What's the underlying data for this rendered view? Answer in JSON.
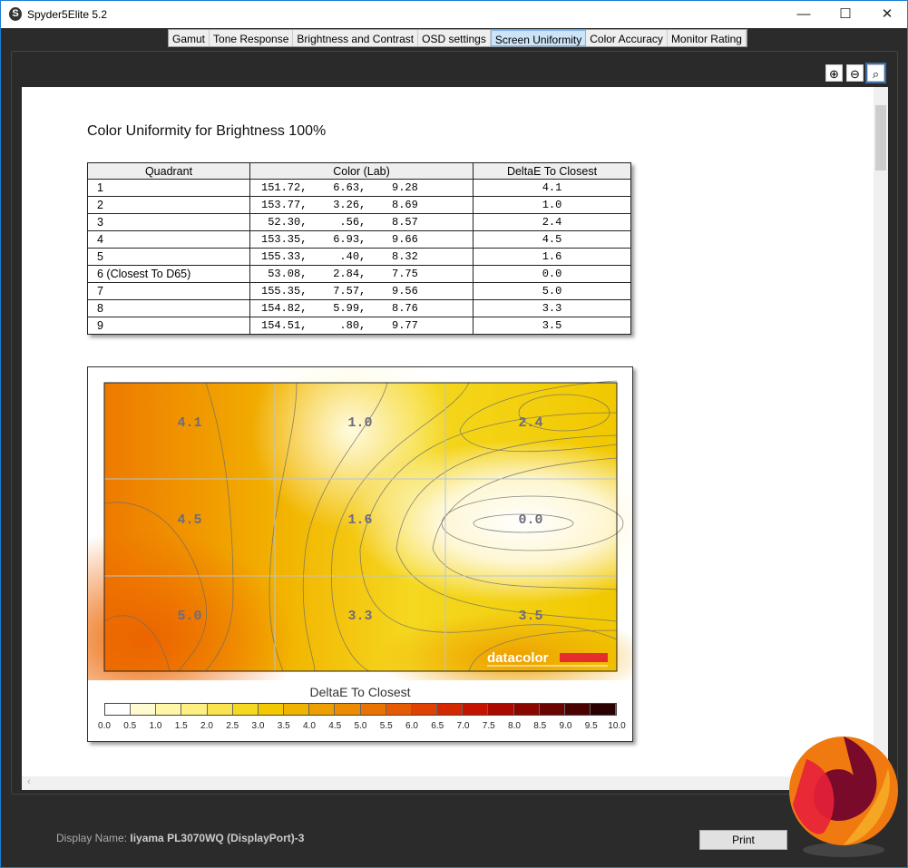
{
  "window": {
    "title": "Spyder5Elite 5.2",
    "minimize": "—",
    "maximize": "☐",
    "close": "✕"
  },
  "tabs": [
    "Gamut",
    "Tone Response",
    "Brightness and Contrast",
    "OSD settings",
    "Screen Uniformity",
    "Color Accuracy",
    "Monitor Rating"
  ],
  "active_tab": "Screen Uniformity",
  "zoom": {
    "in": "⊕",
    "out": "⊖",
    "fit": "🔍"
  },
  "report": {
    "title": "Color Uniformity for Brightness 100%",
    "columns": [
      "Quadrant",
      "Color (Lab)",
      "DeltaE To Closest"
    ],
    "rows": [
      [
        "1",
        "151.72,    6.63,    9.28",
        "4.1"
      ],
      [
        "2",
        "153.77,    3.26,    8.69",
        "1.0"
      ],
      [
        "3",
        " 52.30,     .56,    8.57",
        "2.4"
      ],
      [
        "4",
        "153.35,    6.93,    9.66",
        "4.5"
      ],
      [
        "5",
        "155.33,     .40,    8.32",
        "1.6"
      ],
      [
        "6 (Closest To D65)",
        " 53.08,    2.84,    7.75",
        "0.0"
      ],
      [
        "7",
        "155.35,    7.57,    9.56",
        "5.0"
      ],
      [
        "8",
        "154.82,    5.99,    8.76",
        "3.3"
      ],
      [
        "9",
        "154.51,     .80,    9.77",
        "3.5"
      ]
    ]
  },
  "chart_data": {
    "type": "heatmap",
    "grid": [
      [
        4.1,
        1.0,
        2.4
      ],
      [
        4.5,
        1.6,
        0.0
      ],
      [
        5.0,
        3.3,
        3.5
      ]
    ],
    "labels": [
      "4.1",
      "1.0",
      "2.4",
      "4.5",
      "1.6",
      "0.0",
      "5.0",
      "3.3",
      "3.5"
    ],
    "colorbar_title": "DeltaE To Closest",
    "colorbar_range": [
      0,
      10
    ],
    "colorbar_ticks": [
      "0.0",
      "0.5",
      "1.0",
      "1.5",
      "2.0",
      "2.5",
      "3.0",
      "3.5",
      "4.0",
      "4.5",
      "5.0",
      "5.5",
      "6.0",
      "6.5",
      "7.0",
      "7.5",
      "8.0",
      "8.5",
      "9.0",
      "9.5",
      "10.0"
    ],
    "brand": "datacolor"
  },
  "footer": {
    "display_label": "Display Name:",
    "display_value": "Iiyama PL3070WQ (DisplayPort)-3",
    "print": "Print"
  },
  "hscroll_arrow": "‹"
}
